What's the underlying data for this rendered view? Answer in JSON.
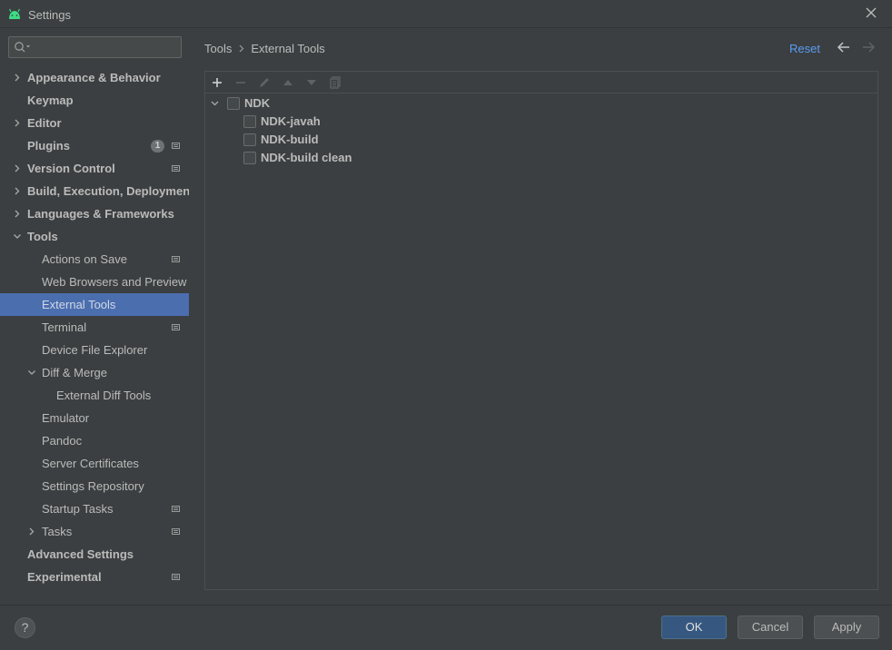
{
  "window": {
    "title": "Settings",
    "app_icon": "android-icon",
    "close_icon": "close-icon"
  },
  "search": {
    "placeholder": "",
    "icon": "search-icon"
  },
  "sidebar": {
    "items": [
      {
        "label": "Appearance & Behavior",
        "bold": true,
        "expandable": true,
        "expanded": false
      },
      {
        "label": "Keymap",
        "bold": true
      },
      {
        "label": "Editor",
        "bold": true,
        "expandable": true,
        "expanded": false
      },
      {
        "label": "Plugins",
        "bold": true,
        "badge": "1",
        "marker": true
      },
      {
        "label": "Version Control",
        "bold": true,
        "expandable": true,
        "expanded": false,
        "marker": true
      },
      {
        "label": "Build, Execution, Deployment",
        "bold": true,
        "expandable": true,
        "expanded": false
      },
      {
        "label": "Languages & Frameworks",
        "bold": true,
        "expandable": true,
        "expanded": false
      },
      {
        "label": "Tools",
        "bold": true,
        "expandable": true,
        "expanded": true
      },
      {
        "label": "Actions on Save",
        "marker": true
      },
      {
        "label": "Web Browsers and Preview"
      },
      {
        "label": "External Tools",
        "selected": true
      },
      {
        "label": "Terminal",
        "marker": true
      },
      {
        "label": "Device File Explorer"
      },
      {
        "label": "Diff & Merge",
        "expandable": true,
        "expanded": true
      },
      {
        "label": "External Diff Tools"
      },
      {
        "label": "Emulator"
      },
      {
        "label": "Pandoc"
      },
      {
        "label": "Server Certificates"
      },
      {
        "label": "Settings Repository"
      },
      {
        "label": "Startup Tasks",
        "marker": true
      },
      {
        "label": "Tasks",
        "expandable": true,
        "expanded": false,
        "marker": true
      },
      {
        "label": "Advanced Settings",
        "bold": true
      },
      {
        "label": "Experimental",
        "bold": true,
        "marker": true
      }
    ]
  },
  "breadcrumb": {
    "parent": "Tools",
    "current": "External Tools",
    "separator_icon": "chevron-right-icon"
  },
  "header": {
    "reset_label": "Reset",
    "back_icon": "arrow-left-icon",
    "forward_icon": "arrow-right-icon"
  },
  "toolbar": {
    "buttons": [
      "add-icon",
      "remove-icon",
      "edit-icon",
      "move-up-icon",
      "move-down-icon",
      "copy-icon"
    ]
  },
  "tools_tree": {
    "group": {
      "label": "NDK",
      "checked": false,
      "expanded": true
    },
    "items": [
      {
        "label": "NDK-javah",
        "checked": false
      },
      {
        "label": "NDK-build",
        "checked": false
      },
      {
        "label": "NDK-build clean",
        "checked": false
      }
    ]
  },
  "footer": {
    "help_label": "?",
    "ok_label": "OK",
    "cancel_label": "Cancel",
    "apply_label": "Apply"
  },
  "colors": {
    "background": "#3c3f41",
    "selection": "#4b6eaf",
    "link": "#589df6",
    "primary_button": "#365880",
    "android_green": "#3ddc84"
  }
}
